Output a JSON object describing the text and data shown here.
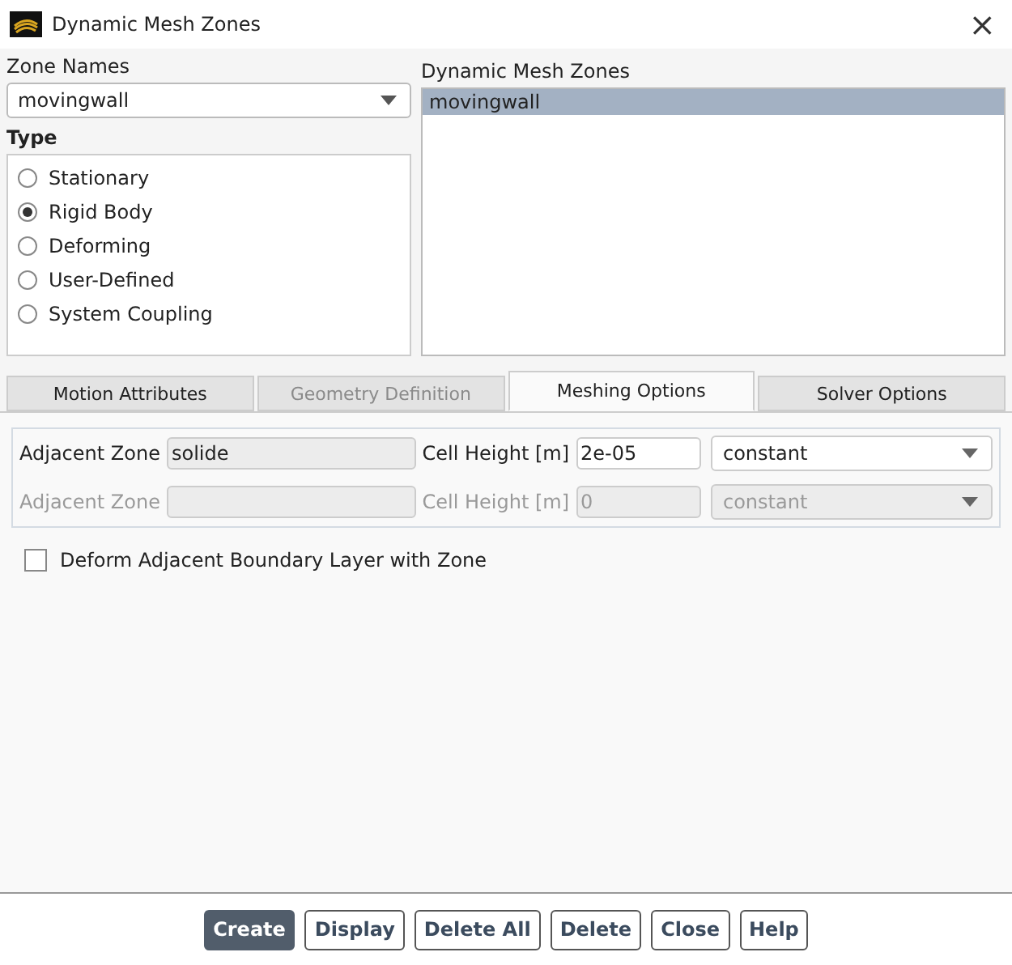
{
  "window": {
    "title": "Dynamic Mesh Zones",
    "close": "×"
  },
  "zone_names": {
    "label": "Zone Names",
    "value": "movingwall"
  },
  "type": {
    "label": "Type",
    "options": [
      {
        "label": "Stationary",
        "selected": false
      },
      {
        "label": "Rigid Body",
        "selected": true
      },
      {
        "label": "Deforming",
        "selected": false
      },
      {
        "label": "User-Defined",
        "selected": false
      },
      {
        "label": "System Coupling",
        "selected": false
      }
    ]
  },
  "dynamic_mesh_zones": {
    "label": "Dynamic Mesh Zones",
    "items": [
      {
        "label": "movingwall",
        "selected": true
      }
    ]
  },
  "tabs": [
    {
      "label": "Motion Attributes",
      "selected": false,
      "disabled": false
    },
    {
      "label": "Geometry Definition",
      "selected": false,
      "disabled": true
    },
    {
      "label": "Meshing Options",
      "selected": true,
      "disabled": false
    },
    {
      "label": "Solver Options",
      "selected": false,
      "disabled": false
    }
  ],
  "rows": [
    {
      "zone_label": "Adjacent Zone",
      "zone_value": "solide",
      "height_label": "Cell Height [m]",
      "height_value": "2e-05",
      "method": "constant",
      "disabled": false
    },
    {
      "zone_label": "Adjacent Zone",
      "height_label": "Cell Height [m]",
      "height_value": "0",
      "method": "constant",
      "disabled": true
    }
  ],
  "deform_checkbox": {
    "label": "Deform Adjacent Boundary Layer with Zone",
    "checked": false
  },
  "buttons": [
    {
      "label": "Create",
      "default": true
    },
    {
      "label": "Display",
      "default": false
    },
    {
      "label": "Delete All",
      "default": false
    },
    {
      "label": "Delete",
      "default": false
    },
    {
      "label": "Close",
      "default": false
    },
    {
      "label": "Help",
      "default": false
    }
  ]
}
